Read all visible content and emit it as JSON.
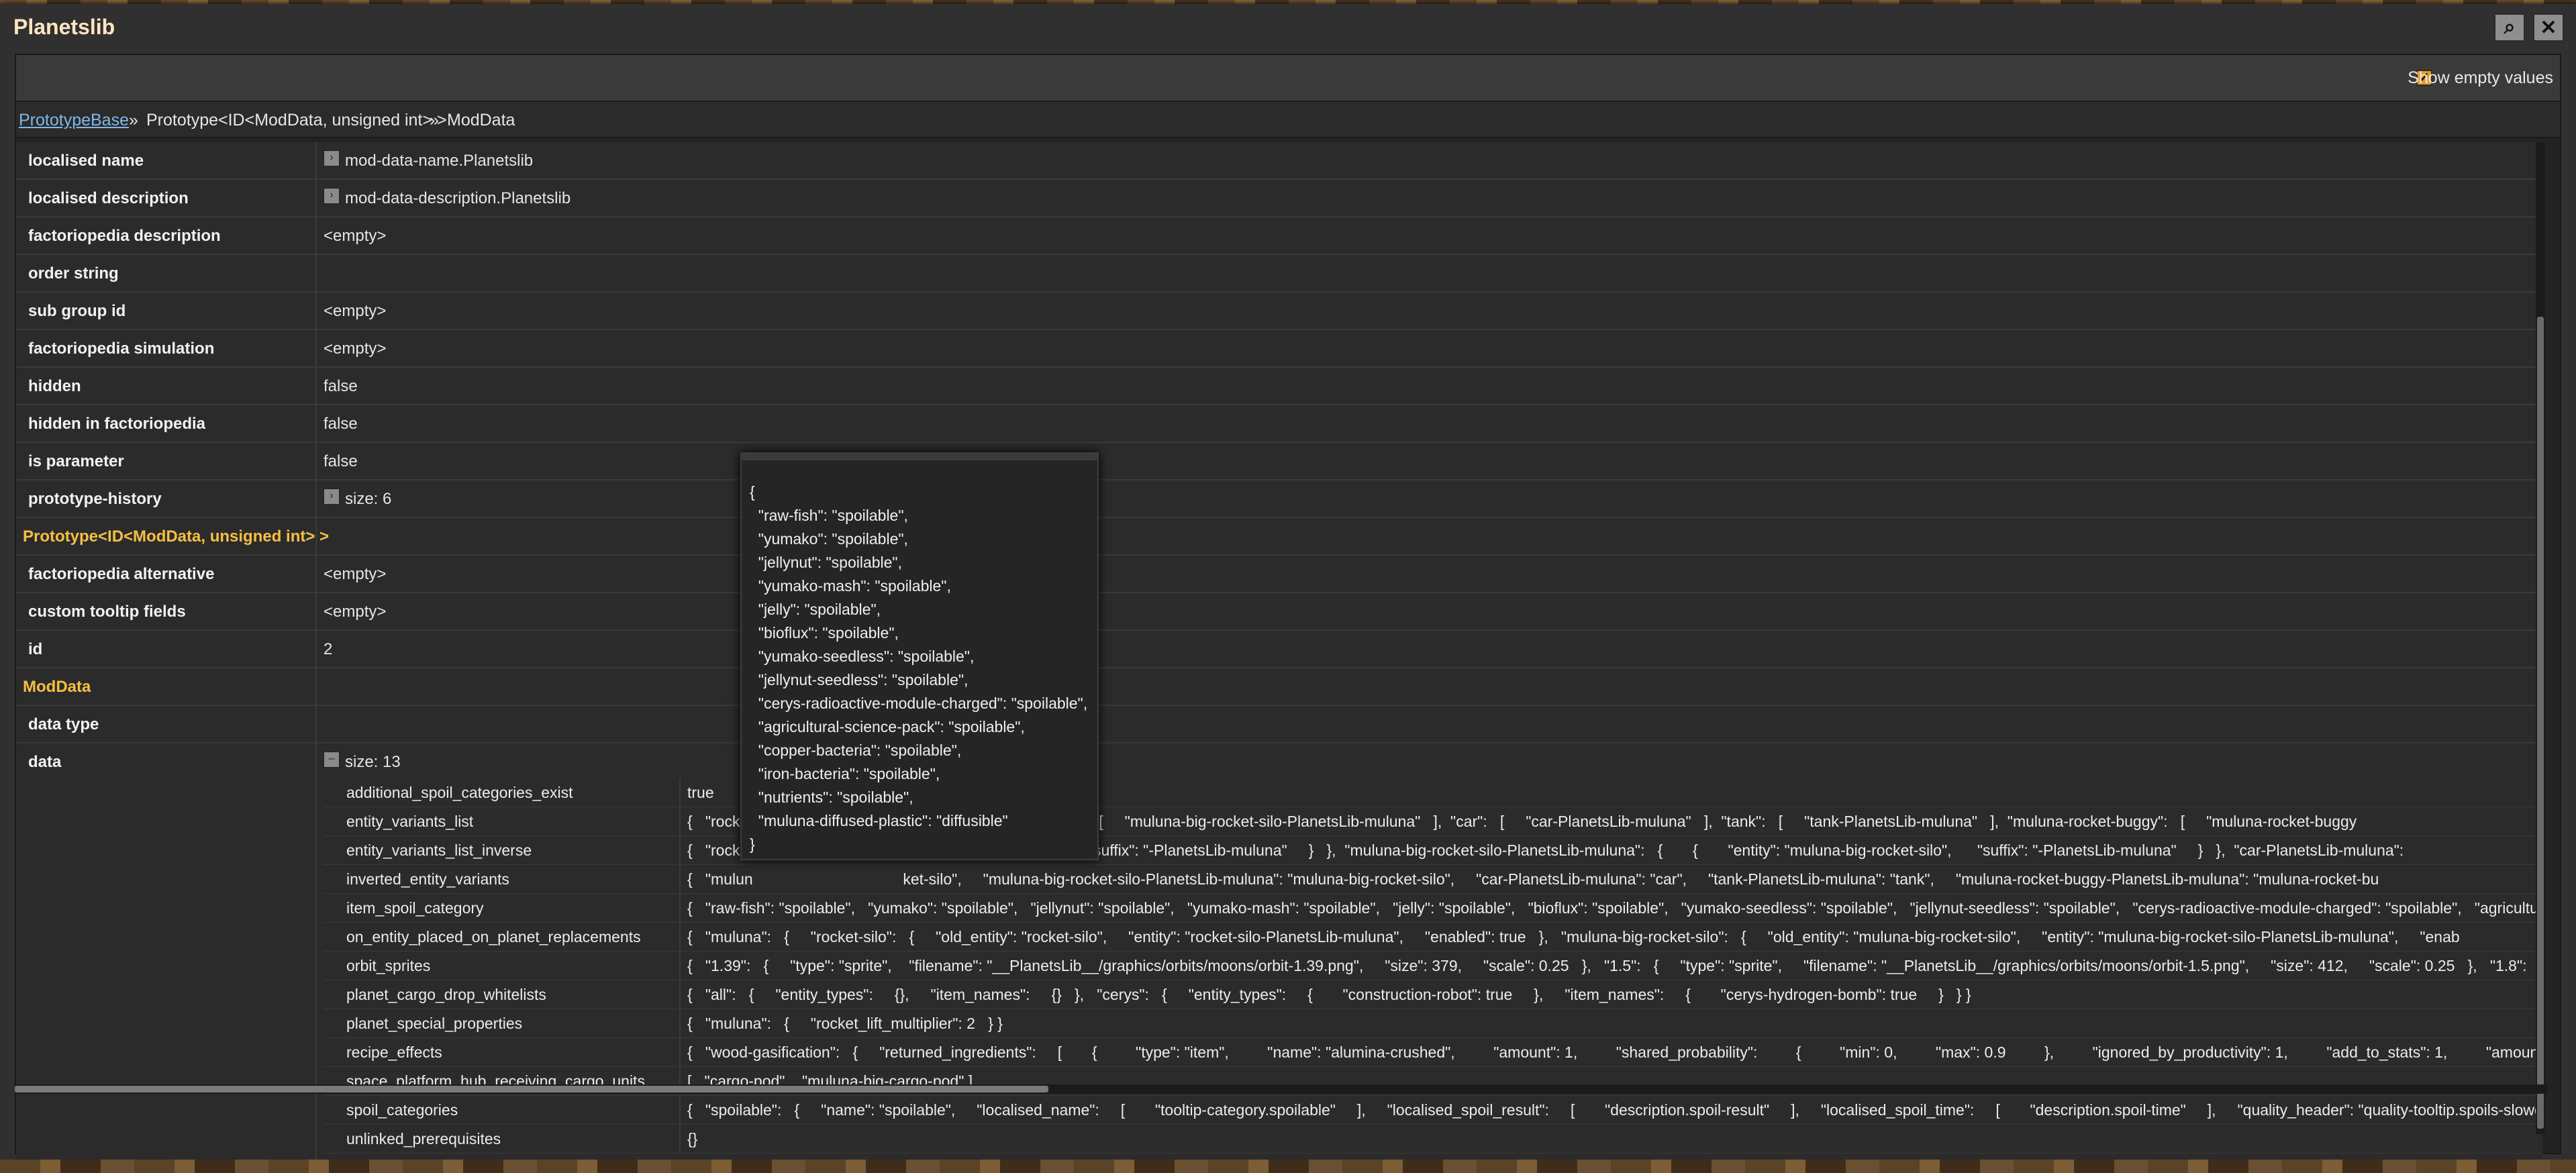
{
  "window": {
    "title": "Planetslib",
    "search_icon": "search-icon",
    "close_icon": "close-icon"
  },
  "options": {
    "show_empty_label": "Show empty values",
    "show_empty_checked": true
  },
  "breadcrumb": {
    "link": "PrototypeBase",
    "sep1": "»",
    "item2": "Prototype<ID<ModData, unsigned int> >",
    "sep2": "»",
    "item3": "ModData"
  },
  "properties": [
    {
      "key": "localised name",
      "value": "mod-data-name.Planetslib",
      "expander": true
    },
    {
      "key": "localised description",
      "value": "mod-data-description.Planetslib",
      "expander": true
    },
    {
      "key": "factoriopedia description",
      "value": "<empty>"
    },
    {
      "key": "order string",
      "value": ""
    },
    {
      "key": "sub group id",
      "value": "<empty>"
    },
    {
      "key": "factoriopedia simulation",
      "value": "<empty>"
    },
    {
      "key": "hidden",
      "value": "false"
    },
    {
      "key": "hidden in factoriopedia",
      "value": "false"
    },
    {
      "key": "is parameter",
      "value": "false"
    },
    {
      "key": "prototype-history",
      "value": "size: 6",
      "expander": true
    },
    {
      "section": "Prototype<ID<ModData, unsigned int> >"
    },
    {
      "key": "factoriopedia alternative",
      "value": "<empty>"
    },
    {
      "key": "custom tooltip fields",
      "value": "<empty>"
    },
    {
      "key": "id",
      "value": "2"
    },
    {
      "section": "ModData"
    },
    {
      "key": "data type",
      "value": ""
    }
  ],
  "data": {
    "key": "data",
    "size": "size: 13",
    "rows": [
      {
        "k": "additional_spoil_categories_exist",
        "v": "true"
      },
      {
        "k": "entity_variants_list",
        "v": "{   \"rocket                                        muluna-big-rocket-silo\":   [     \"muluna-big-rocket-silo-PlanetsLib-muluna\"   ],  \"car\":   [     \"car-PlanetsLib-muluna\"   ],  \"tank\":   [     \"tank-PlanetsLib-muluna\"   ],  \"muluna-rocket-buggy\":   [     \"muluna-rocket-buggy"
      },
      {
        "k": "entity_variants_list_inverse",
        "v": "{   \"rocket                                       \"entity\": \"rocket-silo\",      \"suffix\": \"-PlanetsLib-muluna\"     }   },  \"muluna-big-rocket-silo-PlanetsLib-muluna\":   {       {       \"entity\": \"muluna-big-rocket-silo\",      \"suffix\": \"-PlanetsLib-muluna\"     }   },  \"car-PlanetsLib-muluna\":"
      },
      {
        "k": "inverted_entity_variants",
        "v": "{   \"mulun                                   ket-silo\",     \"muluna-big-rocket-silo-PlanetsLib-muluna\": \"muluna-big-rocket-silo\",     \"car-PlanetsLib-muluna\": \"car\",     \"tank-PlanetsLib-muluna\": \"tank\",     \"muluna-rocket-buggy-PlanetsLib-muluna\": \"muluna-rocket-bu"
      },
      {
        "k": "item_spoil_category",
        "v": "{   \"raw-fish\": \"spoilable\",   \"yumako\": \"spoilable\",   \"jellynut\": \"spoilable\",   \"yumako-mash\": \"spoilable\",   \"jelly\": \"spoilable\",   \"bioflux\": \"spoilable\",   \"yumako-seedless\": \"spoilable\",   \"jellynut-seedless\": \"spoilable\",   \"cerys-radioactive-module-charged\": \"spoilable\",   \"agricultural-sc"
      },
      {
        "k": "on_entity_placed_on_planet_replacements",
        "v": "{   \"muluna\":   {     \"rocket-silo\":   {     \"old_entity\": \"rocket-silo\",     \"entity\": \"rocket-silo-PlanetsLib-muluna\",     \"enabled\": true   },   \"muluna-big-rocket-silo\":   {     \"old_entity\": \"muluna-big-rocket-silo\",     \"entity\": \"muluna-big-rocket-silo-PlanetsLib-muluna\",     \"enab"
      },
      {
        "k": "orbit_sprites",
        "v": "{   \"1.39\":   {     \"type\": \"sprite\",    \"filename\": \"__PlanetsLib__/graphics/orbits/moons/orbit-1.39.png\",     \"size\": 379,     \"scale\": 0.25   },   \"1.5\":   {     \"type\": \"sprite\",     \"filename\": \"__PlanetsLib__/graphics/orbits/moons/orbit-1.5.png\",     \"size\": 412,     \"scale\": 0.25   },   \"1.8\":"
      },
      {
        "k": "planet_cargo_drop_whitelists",
        "v": "{   \"all\":   {     \"entity_types\":     {},     \"item_names\":     {}   },   \"cerys\":   {     \"entity_types\":     {       \"construction-robot\": true     },     \"item_names\":     {       \"cerys-hydrogen-bomb\": true     }   } }"
      },
      {
        "k": "planet_special_properties",
        "v": "{   \"muluna\":   {     \"rocket_lift_multiplier\": 2   } }"
      },
      {
        "k": "recipe_effects",
        "v": "{   \"wood-gasification\":   {     \"returned_ingredients\":     [       {         \"type\": \"item\",         \"name\": \"alumina-crushed\",         \"amount\": 1,         \"shared_probability\":         {         \"min\": 0,         \"max\": 0.9         },         \"ignored_by_productivity\": 1,         \"add_to_stats\": 1,         \"amount"
      },
      {
        "k": "space_platform_hub_receiving_cargo_units",
        "v": "[   \"cargo-pod\",   \"muluna-big-cargo-pod\" ]"
      },
      {
        "k": "spoil_categories",
        "v": "{   \"spoilable\":   {     \"name\": \"spoilable\",     \"localised_name\":     [       \"tooltip-category.spoilable\"     ],     \"localised_spoil_result\":     [       \"description.spoil-result\"     ],     \"localised_spoil_time\":     [       \"description.spoil-time\"     ],     \"quality_header\": \"quality-tooltip.spoils-slower"
      },
      {
        "k": "unlinked_prerequisites",
        "v": "{}"
      }
    ]
  },
  "tooltip": {
    "lines": [
      "{",
      "  \"raw-fish\": \"spoilable\",",
      "  \"yumako\": \"spoilable\",",
      "  \"jellynut\": \"spoilable\",",
      "  \"yumako-mash\": \"spoilable\",",
      "  \"jelly\": \"spoilable\",",
      "  \"bioflux\": \"spoilable\",",
      "  \"yumako-seedless\": \"spoilable\",",
      "  \"jellynut-seedless\": \"spoilable\",",
      "  \"cerys-radioactive-module-charged\": \"spoilable\",",
      "  \"agricultural-science-pack\": \"spoilable\",",
      "  \"copper-bacteria\": \"spoilable\",",
      "  \"iron-bacteria\": \"spoilable\",",
      "  \"nutrients\": \"spoilable\",",
      "  \"muluna-diffused-plastic\": \"diffusible\"",
      "}"
    ]
  }
}
